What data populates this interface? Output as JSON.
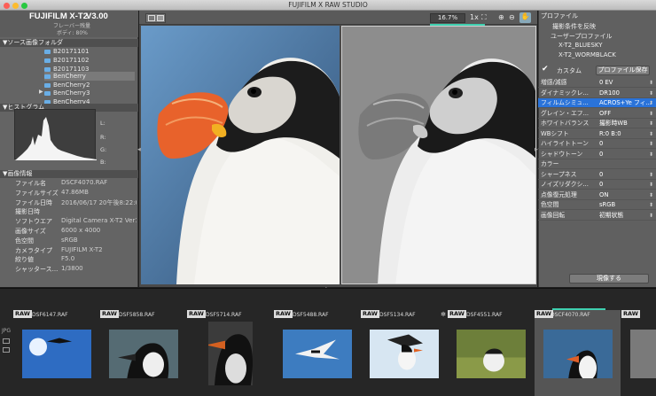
{
  "window": {
    "title": "FUJIFILM X RAW STUDIO"
  },
  "camera": {
    "name": "FUJIFILM X-T2",
    "version": "V3.00",
    "line1": "フレーバー残量",
    "line2": "ボディ: 80%"
  },
  "source": {
    "header": "▼ソース画像フォルダ",
    "folders": [
      "B20171101",
      "B20171102",
      "B20171103",
      "BenCherry",
      "BenCherry2",
      "BenCherry3",
      "BenCherry4"
    ]
  },
  "histogram": {
    "header": "▼ヒストグラム",
    "labels": [
      "L:",
      "R:",
      "G:",
      "B:"
    ]
  },
  "info": {
    "header": "▼画像情報",
    "rows": [
      {
        "label": "ファイル名",
        "value": "DSCF4070.RAF"
      },
      {
        "label": "ファイルサイズ",
        "value": "47.86MB"
      },
      {
        "label": "ファイル日時",
        "value": "2016/06/17 20午後8:22:0"
      },
      {
        "label": "撮影日時",
        "value": ""
      },
      {
        "label": "ソフトウエア",
        "value": "Digital Camera X-T2 Ver1."
      },
      {
        "label": "画像サイズ",
        "value": "6000 x 4000"
      },
      {
        "label": "色空間",
        "value": "sRGB"
      },
      {
        "label": "カメラタイプ",
        "value": "FUJIFILM X-T2"
      },
      {
        "label": "絞り値",
        "value": "F5.0"
      },
      {
        "label": "シャッタース...",
        "value": "1/3800"
      }
    ]
  },
  "toolbar": {
    "zoom": "16.7%",
    "view_icon": "▣ ▨"
  },
  "profile": {
    "header": "プロファイル",
    "apply": "撮影条件を反映",
    "user": "ユーザープロファイル",
    "p1": "X-T2_BLUESKY",
    "p2": "X-T2_WORMBLACK",
    "custom": "カスタム",
    "save_btn": "プロファイル保存",
    "process_btn": "現像する"
  },
  "params": [
    {
      "label": "増感/減感",
      "value": "0 EV"
    },
    {
      "label": "ダイナミックレ...",
      "value": "DR100"
    },
    {
      "label": "フィルムシミュ...",
      "value": "ACROS+Ye フィ..."
    },
    {
      "label": "グレイン・エフ...",
      "value": "OFF"
    },
    {
      "label": "ホワイトバランス",
      "value": "撮影時WB"
    },
    {
      "label": "WBシフト",
      "value": "R:0 B:0"
    },
    {
      "label": "ハイライトトーン",
      "value": "0"
    },
    {
      "label": "シャドウトーン",
      "value": "0"
    },
    {
      "label": "カラー",
      "value": ""
    },
    {
      "label": "シャープネス",
      "value": "0"
    },
    {
      "label": "ノイズリダクシ...",
      "value": "0"
    },
    {
      "label": "点像復元処理",
      "value": "ON"
    },
    {
      "label": "色空間",
      "value": "sRGB"
    },
    {
      "label": "画像回転",
      "value": "初期状態"
    }
  ],
  "filmstrip": [
    {
      "raw": "RAW",
      "name": "_DSF6147.RAF"
    },
    {
      "raw": "RAW",
      "name": "_DSF5858.RAF"
    },
    {
      "raw": "RAW",
      "name": "_DSF5714.RAF"
    },
    {
      "raw": "RAW",
      "name": "_DSF5488.RAF"
    },
    {
      "raw": "RAW",
      "name": "_DSF5134.RAF"
    },
    {
      "raw": "RAW",
      "name": "_DSF4551.RAF"
    },
    {
      "raw": "RAW",
      "name": "DSCF4070.RAF"
    },
    {
      "raw": "RAW",
      "name": ""
    }
  ],
  "strip_side": {
    "label": "JPG"
  }
}
